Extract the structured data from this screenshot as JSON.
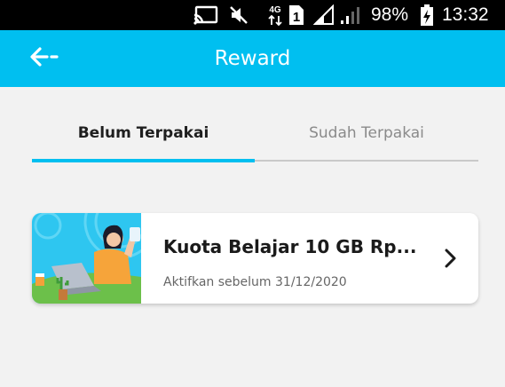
{
  "status_bar": {
    "icons": [
      "cast-icon",
      "mute-icon",
      "network-4g-icon",
      "sim-1-icon",
      "signal-sim1-icon",
      "signal-sim2-icon",
      "battery-charging-icon"
    ],
    "battery": "98%",
    "time": "13:32",
    "network_label": "4G",
    "sim_label": "1"
  },
  "app_bar": {
    "title": "Reward",
    "background_color": "#00bff0",
    "back_icon": "back-arrow-icon"
  },
  "tabs": [
    {
      "label": "Belum Terpakai",
      "active": true
    },
    {
      "label": "Sudah Terpakai",
      "active": false
    }
  ],
  "accent_color": "#00bff0",
  "rewards": [
    {
      "title": "Kuota Belajar 10 GB Rp...",
      "subtitle": "Aktifkan sebelum 31/12/2020",
      "image": "illustration-woman-laptop",
      "action_icon": "chevron-right-icon"
    }
  ]
}
